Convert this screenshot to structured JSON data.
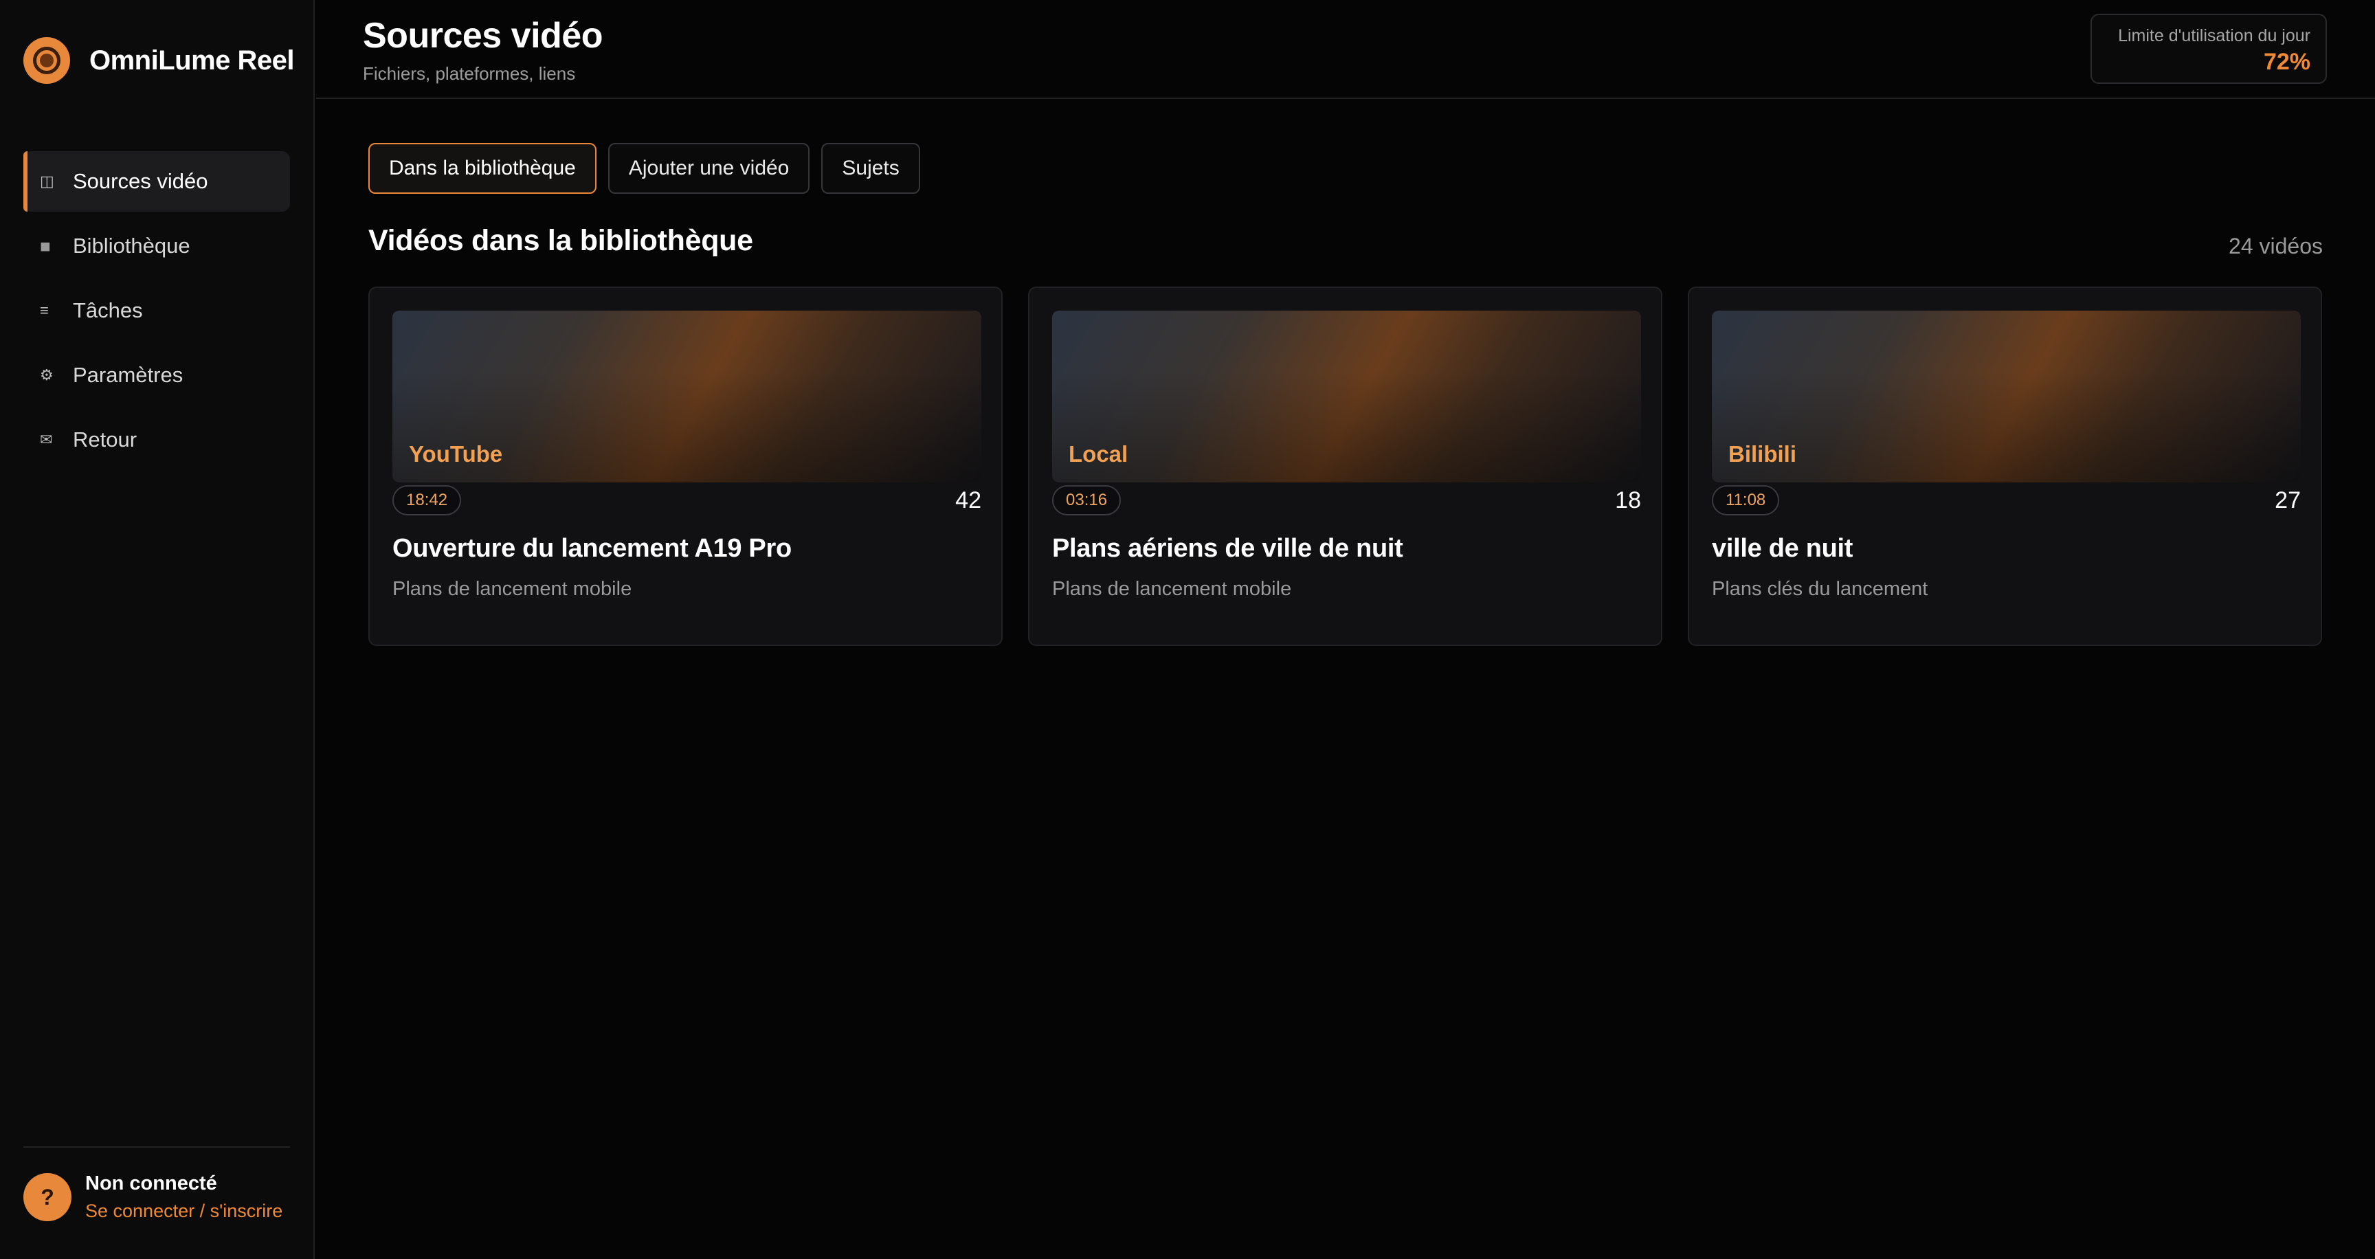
{
  "app": {
    "name": "OmniLume Reel",
    "accent_color": "#e8883a"
  },
  "sidebar": {
    "items": [
      {
        "label": "Sources vidéo",
        "icon": "columns-icon",
        "active": true
      },
      {
        "label": "Bibliothèque",
        "icon": "square-icon",
        "active": false
      },
      {
        "label": "Tâches",
        "icon": "list-icon",
        "active": false
      },
      {
        "label": "Paramètres",
        "icon": "gear-icon",
        "active": false
      },
      {
        "label": "Retour",
        "icon": "mail-icon",
        "active": false
      }
    ],
    "user": {
      "avatar_symbol": "?",
      "status": "Non connecté",
      "login_link": "Se connecter / s'inscrire"
    }
  },
  "header": {
    "title": "Sources vidéo",
    "subtitle": "Fichiers, plateformes, liens",
    "quota_label": "Limite d'utilisation du jour",
    "quota_value": "72%"
  },
  "tabs": [
    {
      "label": "Dans la bibliothèque",
      "active": true
    },
    {
      "label": "Ajouter une vidéo",
      "active": false
    },
    {
      "label": "Sujets",
      "active": false
    }
  ],
  "library": {
    "title": "Vidéos dans la bibliothèque",
    "count_label": "24 vidéos",
    "videos": [
      {
        "source": "YouTube",
        "duration": "18:42",
        "count": "42",
        "title": "Ouverture du lancement A19 Pro",
        "subtitle": "Plans de lancement mobile"
      },
      {
        "source": "Local",
        "duration": "03:16",
        "count": "18",
        "title": "Plans aériens de ville de nuit",
        "subtitle": "Plans de lancement mobile"
      },
      {
        "source": "Bilibili",
        "duration": "11:08",
        "count": "27",
        "title": "ville de nuit",
        "subtitle": "Plans clés du lancement"
      }
    ]
  }
}
